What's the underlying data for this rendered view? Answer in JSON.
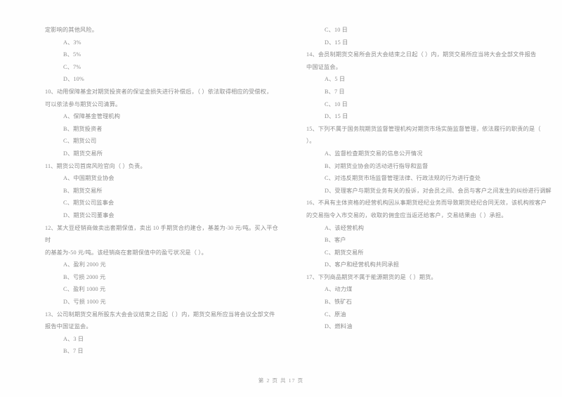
{
  "document": {
    "footer": "第 2 页  共 17 页",
    "page_number": 2,
    "total_pages": 17,
    "text_color": "#8c8c8c",
    "background_color": "#fefefe"
  },
  "left_column": {
    "q9_tail": {
      "stem": "定影响的其他风险。",
      "options": [
        "A、3%",
        "B、5%",
        "C、7%",
        "D、10%"
      ]
    },
    "q10": {
      "stem_line1": "10、动用保障基金对期货投资者的保证金损失进行补偿后，（      ）依法取得相应的受偿权，",
      "stem_line2": "可以依法参与期货公司清算。",
      "options": [
        "A、保障基金管理机构",
        "B、期货投资者",
        "C、期货公司",
        "D、期货交易所"
      ]
    },
    "q11": {
      "stem_line1": "11、期货公司首席风险官向（      ）负责。",
      "options": [
        "A、中国期货业协会",
        "B、期货交易所",
        "C、期货公司监事会",
        "D、期货公司董事会"
      ]
    },
    "q12": {
      "stem_line1": "12、某大豆经销商做卖出套期保值，卖出 10 手期货合约建仓，基差为-30 元/吨。买入平仓时",
      "stem_line2": "的基差为-50 元/吨。该经销商在套期保值中的盈亏状况是（      ）。",
      "options": [
        "A、盈利 2000 元",
        "B、亏损 2000 元",
        "C、盈利 1000 元",
        "D、亏损 1000 元"
      ]
    },
    "q13": {
      "stem_line1": "13、公司制期货交易所股东大会会议结束之日起（      ）内，期货交易所应当将会议全部文件",
      "stem_line2": "报告中国证监会。",
      "options": [
        "A、3 日",
        "B、7 日"
      ]
    }
  },
  "right_column": {
    "q13_tail": {
      "options": [
        "C、10 日",
        "D、15 日"
      ]
    },
    "q14": {
      "stem_line1": "14、会员制期货交易所会员大会结束之日起（      ）内，期货交易所应当将大会全部文件报告",
      "stem_line2": "中国证监会。",
      "options": [
        "A、5 日",
        "B、7 日",
        "C、10 日",
        "D、15 日"
      ]
    },
    "q15": {
      "stem_line1": "15、下列不属于国务院期货监督管理机构对期货市场实施监督管理，依法履行的职责的是（",
      "stem_line2": "）。",
      "options": [
        "A、监督检查期货交易的信息公开情况",
        "B、对期货业协会的活动进行指导和监督",
        "C、对违反期货市场监督管理法律、行政法规的行为进行查处",
        "D、受理客户与期货业务有关的投诉，对会员之间、会员与客户之间发生的纠纷进行调解"
      ]
    },
    "q16": {
      "stem_line1": "16、不具有主体资格的经营机构因从事期货经纪业务而导致期货经纪合同无效，该机构按客户",
      "stem_line2": "的交易指令入市交易的，收取的佣金应当返还给客户，交易结果由（      ）承担。",
      "options": [
        "A、该经营机构",
        "B、客户",
        "C、期货交易所",
        "D、客户和经营机构共同承担"
      ]
    },
    "q17": {
      "stem_line1": "17、下列商品期货不属于能源期货的是（      ）期货。",
      "options": [
        "A、动力煤",
        "B、铁矿石",
        "C、原油",
        "D、燃料油"
      ]
    }
  }
}
